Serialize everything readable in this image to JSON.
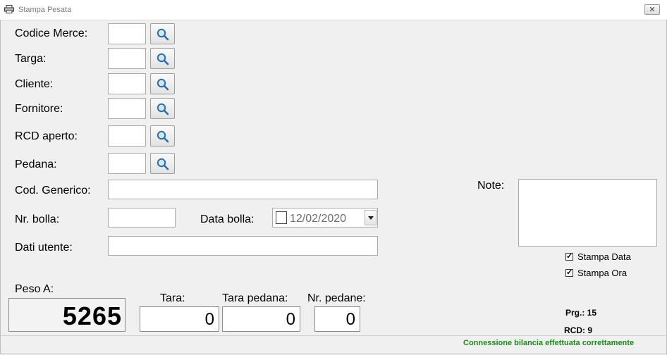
{
  "window": {
    "title": "Stampa Pesata"
  },
  "labels": {
    "codice_merce": "Codice Merce:",
    "targa": "Targa:",
    "cliente": "Cliente:",
    "fornitore": "Fornitore:",
    "rcd_aperto": "RCD aperto:",
    "pedana": "Pedana:",
    "cod_generico": "Cod. Generico:",
    "nr_bolla": "Nr. bolla:",
    "data_bolla": "Data bolla:",
    "dati_utente": "Dati utente:",
    "note": "Note:",
    "peso_a": "Peso A:",
    "tara": "Tara:",
    "tara_pedana": "Tara pedana:",
    "nr_pedane": "Nr. pedane:"
  },
  "fields": {
    "codice_merce": "",
    "targa": "",
    "cliente": "",
    "fornitore": "",
    "rcd_aperto": "",
    "pedana": "",
    "cod_generico": "",
    "nr_bolla": "",
    "dati_utente": "",
    "note": "",
    "data_bolla": "12/02/2020"
  },
  "options": {
    "stampa_data": {
      "label": "Stampa Data",
      "checked": true
    },
    "stampa_ora": {
      "label": "Stampa Ora",
      "checked": true
    }
  },
  "weights": {
    "peso_a": "5265",
    "tara": "0",
    "tara_pedana": "0",
    "nr_pedane": "0"
  },
  "info": {
    "prg": "Prg.: 15",
    "rcd": "RCD: 9"
  },
  "status": "Connessione bilancia effettuata correttamente",
  "icons": {
    "search": "magnifier-icon",
    "window": "printer-icon"
  }
}
